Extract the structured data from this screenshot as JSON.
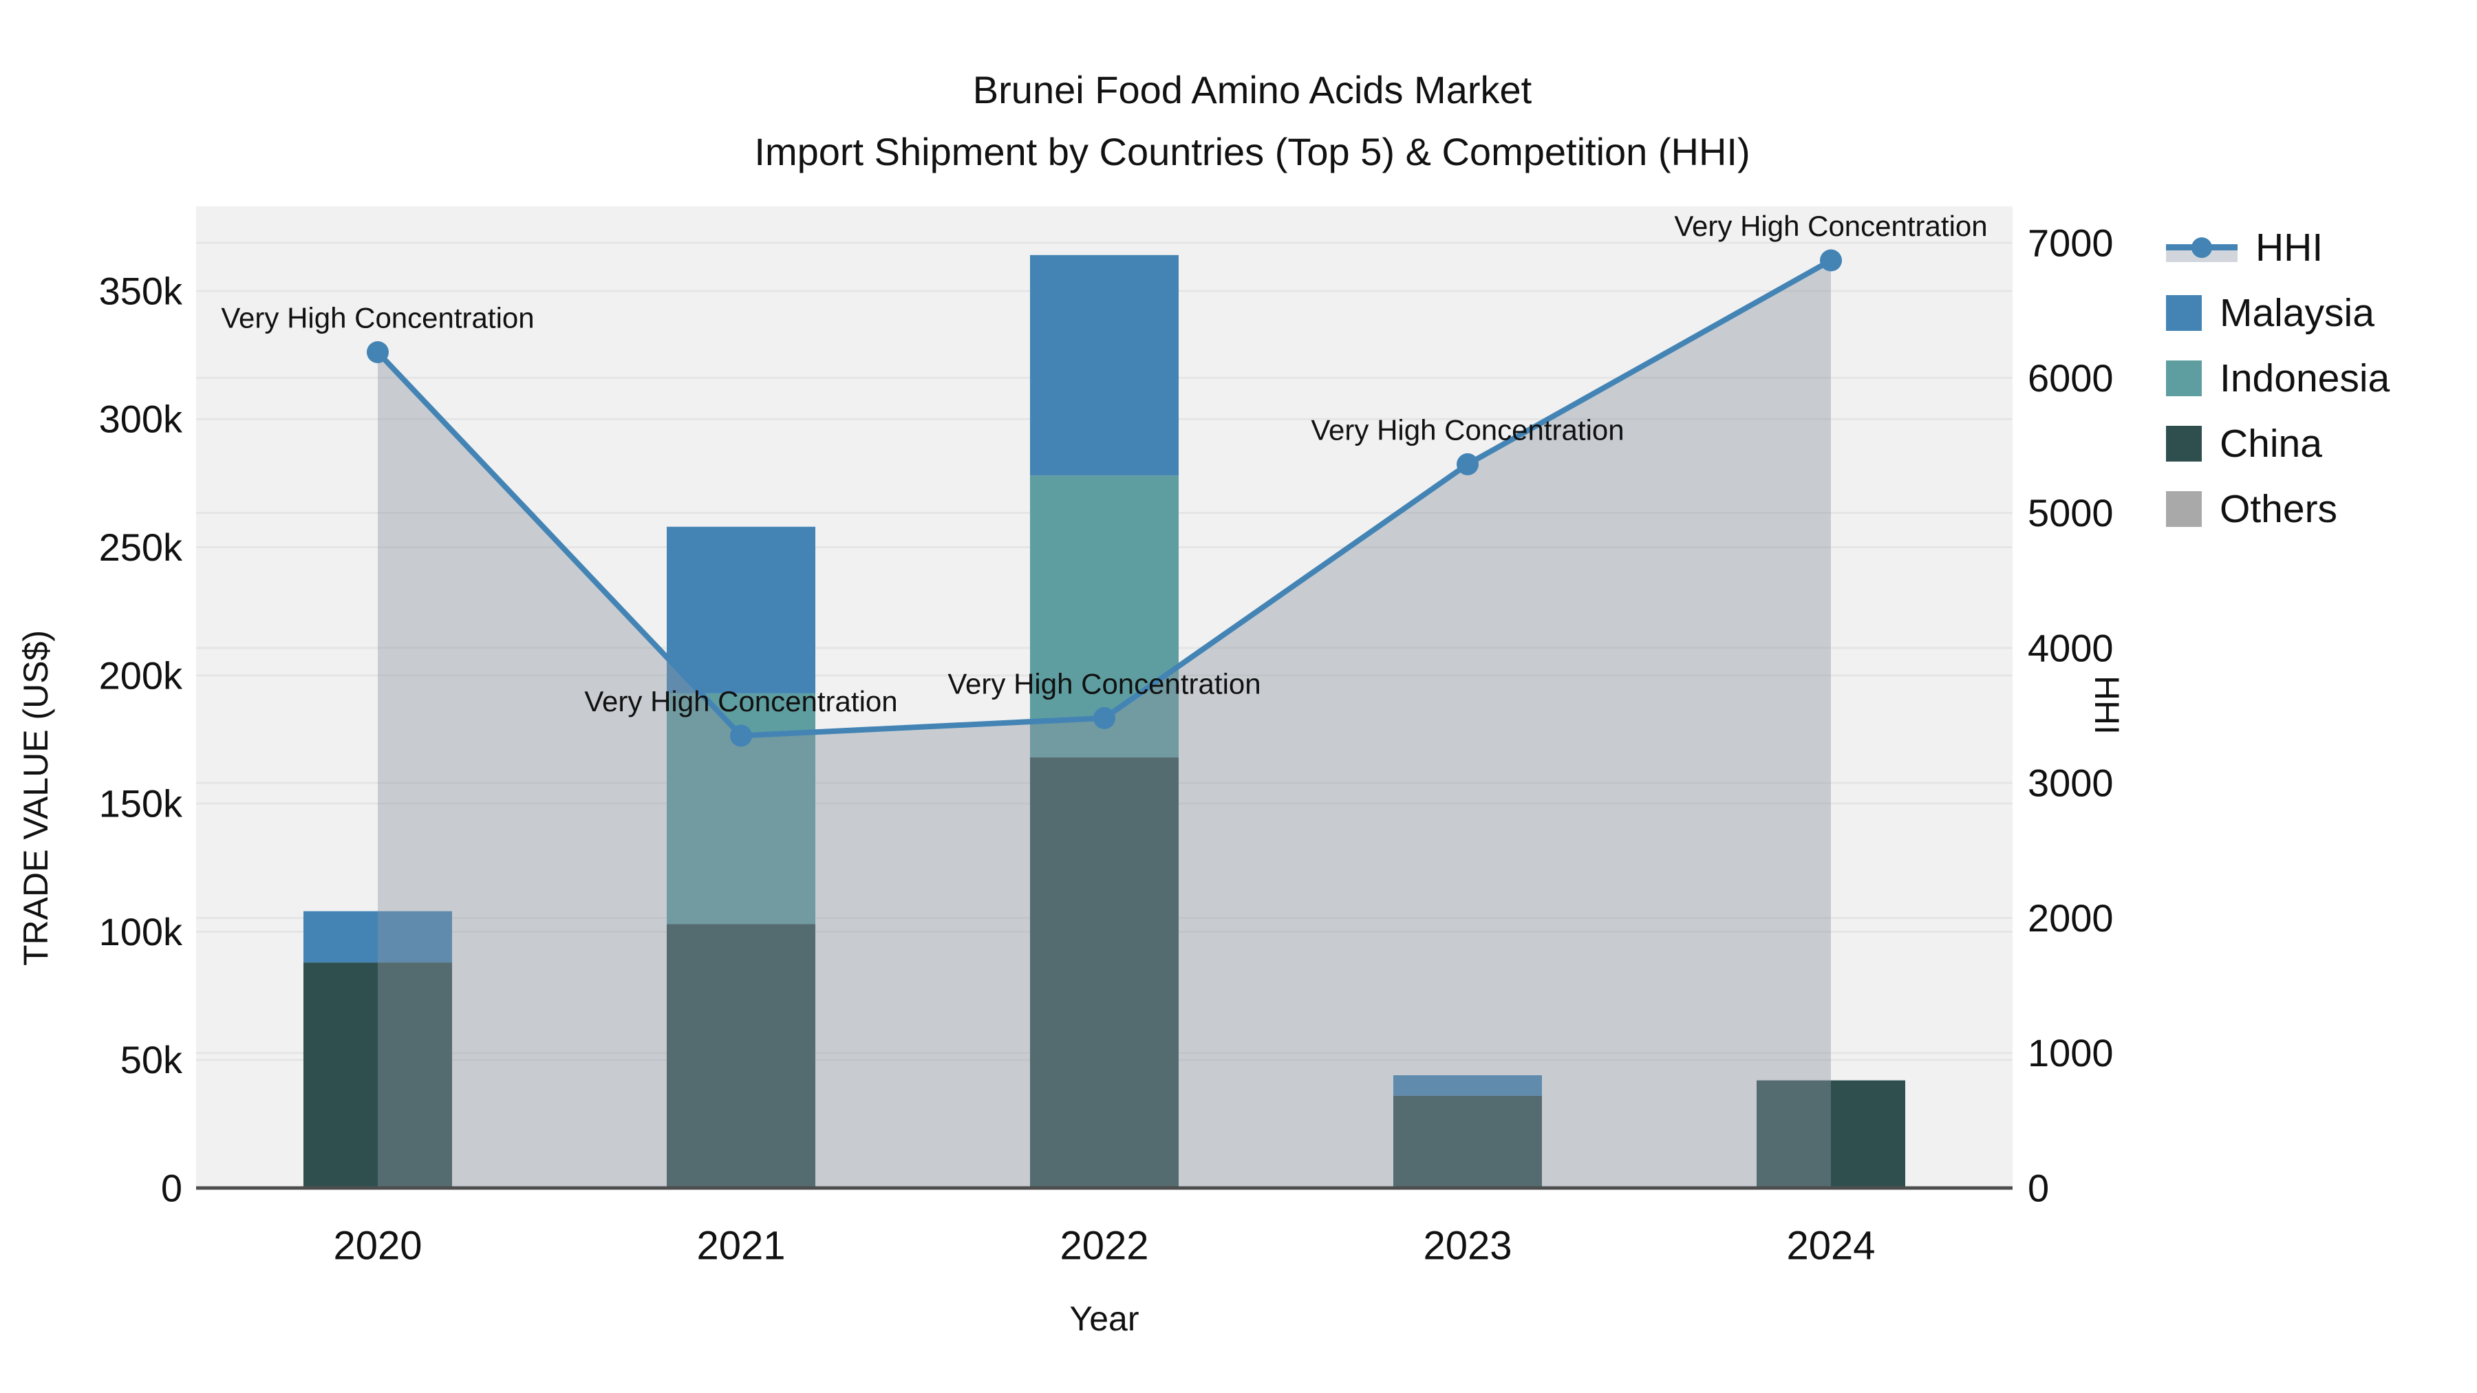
{
  "title": {
    "line1": "Brunei Food Amino Acids Market",
    "line2": "Import Shipment by Countries (Top 5) & Competition (HHI)"
  },
  "chart_data": {
    "type": "combo: stacked bar (trade value) + line with gray area fill (HHI)",
    "categories": [
      "2020",
      "2021",
      "2022",
      "2023",
      "2024"
    ],
    "bar_series": [
      {
        "name": "Malaysia",
        "color": "#4384B5",
        "values": [
          20000,
          65000,
          86000,
          8000,
          0
        ]
      },
      {
        "name": "Indonesia",
        "color": "#5F9EA0",
        "values": [
          0,
          90000,
          110000,
          0,
          0
        ]
      },
      {
        "name": "China",
        "color": "#2F4F4F",
        "values": [
          88000,
          103000,
          168000,
          36000,
          42000
        ]
      },
      {
        "name": "Others",
        "color": "#A9A9A9",
        "values": [
          0,
          0,
          0,
          0,
          0
        ]
      }
    ],
    "bar_totals": [
      108000,
      258000,
      364000,
      44000,
      42000
    ],
    "line_series": {
      "name": "HHI",
      "color": "#4384B5",
      "fill_color": "rgba(140,150,163,0.40)",
      "values": [
        6190,
        3350,
        3480,
        5360,
        6870
      ]
    },
    "annotation_text": "Very High Concentration",
    "y_left": {
      "title": "TRADE VALUE (US$)",
      "ticks": [
        "0",
        "50k",
        "100k",
        "150k",
        "200k",
        "250k",
        "300k",
        "350k"
      ],
      "tick_values": [
        0,
        50000,
        100000,
        150000,
        200000,
        250000,
        300000,
        350000
      ],
      "range": [
        0,
        383000
      ]
    },
    "y_right": {
      "title": "HHI",
      "ticks": [
        "0",
        "1000",
        "2000",
        "3000",
        "4000",
        "5000",
        "6000",
        "7000"
      ],
      "tick_values": [
        0,
        1000,
        2000,
        3000,
        4000,
        5000,
        6000,
        7000
      ],
      "range": [
        0,
        7270
      ]
    },
    "x": {
      "title": "Year"
    },
    "layout_hints": {
      "grid": "horizontal, both axes",
      "legend_position": "outside top-right",
      "plot_bg": "#F1F1F1"
    }
  },
  "legend": {
    "items": [
      {
        "label": "HHI",
        "type": "line"
      },
      {
        "label": "Malaysia",
        "type": "swatch",
        "color": "#4384B5"
      },
      {
        "label": "Indonesia",
        "type": "swatch",
        "color": "#5F9EA0"
      },
      {
        "label": "China",
        "type": "swatch",
        "color": "#2F4F4F"
      },
      {
        "label": "Others",
        "type": "swatch",
        "color": "#A9A9A9"
      }
    ]
  },
  "colors": {
    "plot_bg": "#F1F1F1",
    "grid": "#E5E5E5",
    "axis_line": "#4D4D4D",
    "text": "#111111"
  }
}
